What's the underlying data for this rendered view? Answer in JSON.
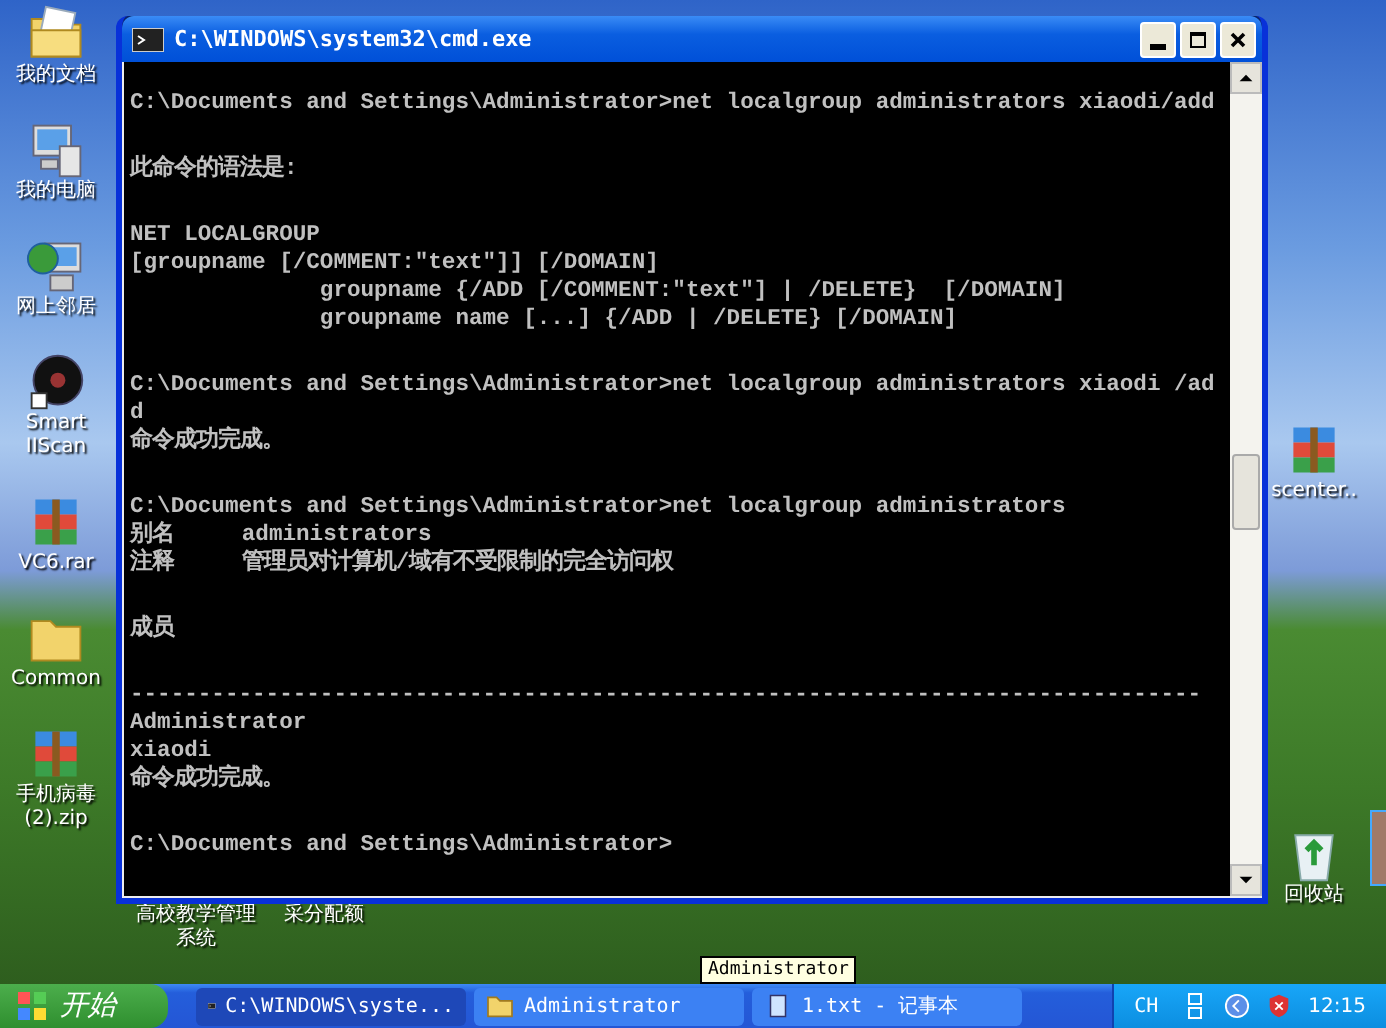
{
  "left_icons": [
    {
      "label": "我的文档",
      "kind": "documents"
    },
    {
      "label": "我的电脑",
      "kind": "computer"
    },
    {
      "label": "网上邻居",
      "kind": "network"
    },
    {
      "label": "Smart IIScan",
      "kind": "disc"
    },
    {
      "label": "VC6.rar",
      "kind": "archive"
    },
    {
      "label": "Common",
      "kind": "folder"
    },
    {
      "label": "手机病毒(2).zip",
      "kind": "archive"
    }
  ],
  "bottom_labels": [
    "高校教学管理系统",
    "采分配额"
  ],
  "right_icons": [
    {
      "label": "scenter..",
      "kind": "archive"
    },
    {
      "label": "回收站",
      "kind": "recycle"
    }
  ],
  "window": {
    "title": "C:\\WINDOWS\\system32\\cmd.exe",
    "console_blocks": [
      [
        "C:\\Documents and Settings\\Administrator>net localgroup administrators xiaodi/add"
      ],
      [
        "此命令的语法是:"
      ],
      [
        "NET LOCALGROUP",
        "[groupname [/COMMENT:\"text\"]] [/DOMAIN]",
        "              groupname {/ADD [/COMMENT:\"text\"] | /DELETE}  [/DOMAIN]",
        "              groupname name [...] {/ADD | /DELETE} [/DOMAIN]"
      ],
      [
        "C:\\Documents and Settings\\Administrator>net localgroup administrators xiaodi /ad",
        "d",
        "命令成功完成。"
      ],
      [
        "C:\\Documents and Settings\\Administrator>net localgroup administrators",
        "别名     administrators",
        "注释     管理员对计算机/域有不受限制的完全访问权"
      ],
      [
        "成员"
      ],
      [
        "-------------------------------------------------------------------------------",
        "Administrator",
        "xiaodi",
        "命令成功完成。"
      ],
      [
        "C:\\Documents and Settings\\Administrator>"
      ]
    ]
  },
  "tooltip": "Administrator",
  "taskbar": {
    "start": "开始",
    "tasks": [
      {
        "label": "C:\\WINDOWS\\syste...",
        "kind": "console",
        "selected": true
      },
      {
        "label": "Administrator",
        "kind": "folder",
        "selected": false
      },
      {
        "label": "1.txt - 记事本",
        "kind": "notepad",
        "selected": false
      }
    ],
    "language": "CH",
    "clock": "12:15"
  }
}
